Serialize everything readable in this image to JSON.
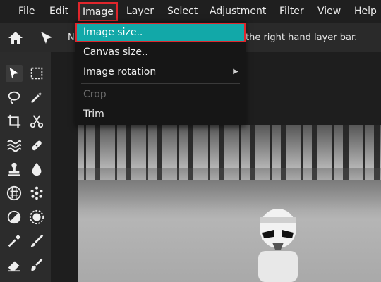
{
  "menu": {
    "items": [
      "File",
      "Edit",
      "Image",
      "Layer",
      "Select",
      "Adjustment",
      "Filter",
      "View",
      "Help"
    ],
    "active": "Image"
  },
  "options_bar": {
    "hint_prefix": "N",
    "hint_text": "the right hand layer bar."
  },
  "image_menu": {
    "items": [
      {
        "label": "Image size..",
        "state": "highlighted"
      },
      {
        "label": "Canvas size..",
        "state": "normal"
      },
      {
        "label": "Image rotation",
        "state": "submenu"
      },
      {
        "label": "Crop",
        "state": "disabled"
      },
      {
        "label": "Trim",
        "state": "normal"
      }
    ]
  },
  "tools": [
    "select-arrow-icon",
    "marquee-icon",
    "lasso-icon",
    "magic-wand-icon",
    "crop-icon",
    "scissors-icon",
    "wave-icon",
    "bandage-icon",
    "stamp-icon",
    "drop-icon",
    "pattern-circle-icon",
    "dots-icon",
    "contrast-icon",
    "sun-icon",
    "eyedropper-icon",
    "brush-icon",
    "eraser-icon",
    "smudge-icon"
  ],
  "colors": {
    "accent": "#12a8a8",
    "highlight_border": "#e0262c"
  }
}
